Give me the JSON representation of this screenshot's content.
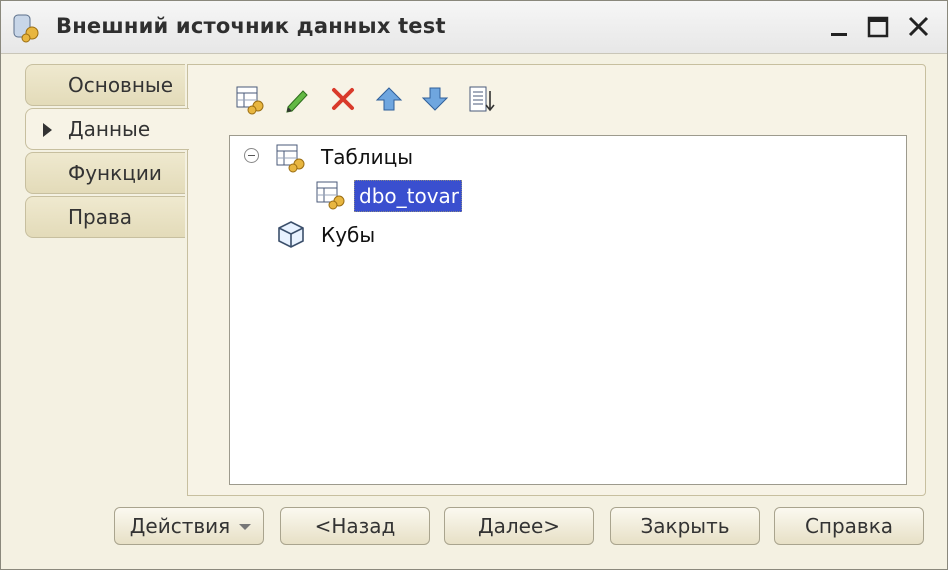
{
  "window": {
    "title": "Внешний источник данных test"
  },
  "tabs": [
    {
      "label": "Основные",
      "active": false
    },
    {
      "label": "Данные",
      "active": true
    },
    {
      "label": "Функции",
      "active": false
    },
    {
      "label": "Права",
      "active": false
    }
  ],
  "toolbar": {
    "icons": [
      "add-table-icon",
      "edit-icon",
      "delete-icon",
      "move-up-icon",
      "move-down-icon",
      "sort-list-icon"
    ]
  },
  "tree": {
    "root_label": "Таблицы",
    "child_label": "dbo_tovar",
    "cubes_label": "Кубы"
  },
  "buttons": {
    "actions": "Действия",
    "back": "<Назад",
    "next": "Далее>",
    "close": "Закрыть",
    "help": "Справка"
  }
}
